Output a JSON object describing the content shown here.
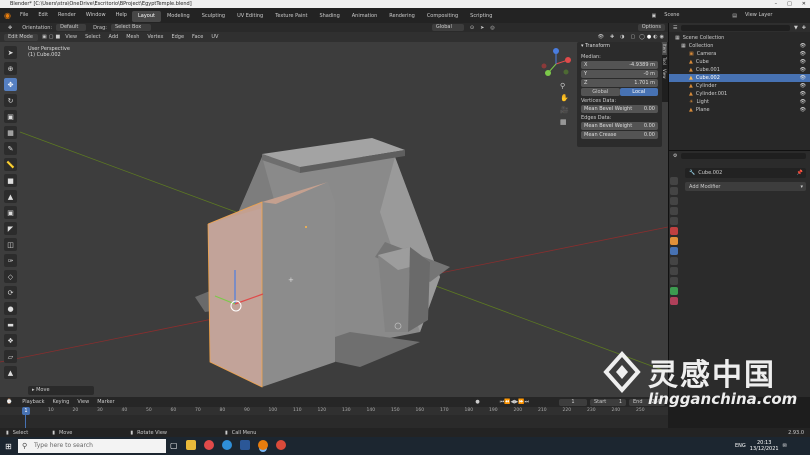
{
  "window": {
    "title": "Blender* [C:\\Users\\stra\\OneDrive\\Escritorio\\BProject\\EgyptTemple.blend]"
  },
  "menu": {
    "items": [
      "File",
      "Edit",
      "Render",
      "Window",
      "Help"
    ],
    "workspaces": [
      "Layout",
      "Modeling",
      "Sculpting",
      "UV Editing",
      "Texture Paint",
      "Shading",
      "Animation",
      "Rendering",
      "Compositing",
      "Scripting"
    ],
    "active_workspace": "Layout",
    "scene_label": "Scene",
    "view_layer_label": "View Layer"
  },
  "header_top": {
    "orientation_label": "Orientation:",
    "orientation_value": "Default",
    "drag_label": "Drag:",
    "drag_value": "Select Box",
    "transform_space": "Global",
    "options_label": "Options"
  },
  "header_view": {
    "mode": "Edit Mode",
    "menus": [
      "View",
      "Select",
      "Add",
      "Mesh",
      "Vertex",
      "Edge",
      "Face",
      "UV"
    ]
  },
  "viewport": {
    "perspective_label": "User Perspective",
    "object_label": "(1) Cube.002",
    "last_op": "Move"
  },
  "npanel": {
    "title": "Transform",
    "median_label": "Median:",
    "x_label": "X",
    "x_value": "-4.9389 m",
    "y_label": "Y",
    "y_value": "-0 m",
    "z_label": "Z",
    "z_value": "1.701 m",
    "global_label": "Global",
    "local_label": "Local",
    "vertices_label": "Vertices Data:",
    "vbevel_label": "Mean Bevel Weight",
    "vbevel_value": "0.00",
    "edges_label": "Edges Data:",
    "ebevel_label": "Mean Bevel Weight",
    "ebevel_value": "0.00",
    "crease_label": "Mean Crease",
    "crease_value": "0.00",
    "tabs": [
      "Item",
      "Tool",
      "View"
    ]
  },
  "outliner": {
    "root": "Scene Collection",
    "collection": "Collection",
    "objects": [
      {
        "name": "Camera",
        "selected": false
      },
      {
        "name": "Cube",
        "selected": false
      },
      {
        "name": "Cube.001",
        "selected": false
      },
      {
        "name": "Cube.002",
        "selected": true
      },
      {
        "name": "Cylinder",
        "selected": false
      },
      {
        "name": "Cylinder.001",
        "selected": false
      },
      {
        "name": "Light",
        "selected": false
      },
      {
        "name": "Plane",
        "selected": false
      }
    ]
  },
  "properties": {
    "object_name": "Cube.002",
    "add_modifier": "Add Modifier"
  },
  "timeline": {
    "menus": [
      "Playback",
      "Keying",
      "View",
      "Marker"
    ],
    "current_frame": "1",
    "start_label": "Start",
    "start_value": "1",
    "end_label": "End",
    "end_value": "250",
    "ticks": [
      "10",
      "20",
      "30",
      "40",
      "50",
      "60",
      "70",
      "80",
      "90",
      "100",
      "110",
      "120",
      "130",
      "140",
      "150",
      "160",
      "170",
      "180",
      "190",
      "200",
      "210",
      "220",
      "230",
      "240",
      "250"
    ]
  },
  "status": {
    "select": "Select",
    "move": "Move",
    "rotate": "Rotate View",
    "call_menu": "Call Menu",
    "version": "2.93.0"
  },
  "taskbar": {
    "search_placeholder": "Type here to search",
    "lang": "ENG",
    "time": "20:13",
    "date": "13/12/2021"
  },
  "watermark": {
    "cn": "灵感中国",
    "url": "lingganchina.com"
  },
  "colors": {
    "accent": "#4772b3",
    "viewport_bg": "#3d3d3d",
    "x_axis": "#c03a3a",
    "y_axis": "#7fae2a",
    "gizmo_x": "#e04a4a",
    "gizmo_y": "#7cc94a",
    "gizmo_z": "#4a7de0"
  }
}
